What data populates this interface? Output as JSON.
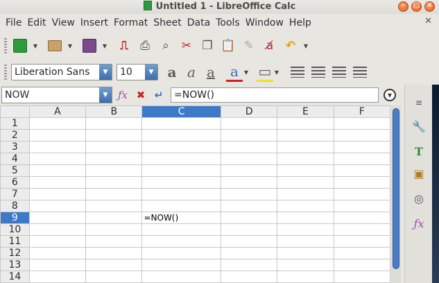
{
  "window": {
    "title": "Untitled 1 - LibreOffice Calc"
  },
  "menu": [
    "File",
    "Edit",
    "View",
    "Insert",
    "Format",
    "Sheet",
    "Data",
    "Tools",
    "Window",
    "Help"
  ],
  "format_bar": {
    "font_name": "Liberation Sans",
    "font_size": "10"
  },
  "formula_bar": {
    "name_box": "NOW",
    "formula": "=NOW()"
  },
  "columns": [
    "A",
    "B",
    "C",
    "D",
    "E",
    "F"
  ],
  "rows": [
    "1",
    "2",
    "3",
    "4",
    "5",
    "6",
    "7",
    "8",
    "9",
    "10",
    "11",
    "12",
    "13",
    "14"
  ],
  "selected": {
    "column": "C",
    "row": "9"
  },
  "cells": {
    "C9": "=NOW()"
  },
  "colors": {
    "selection": "#3d79c6",
    "window_close": "#e05a1c"
  }
}
